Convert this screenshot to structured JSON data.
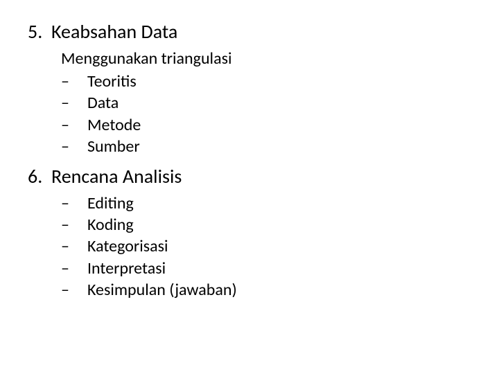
{
  "section5": {
    "number": "5.",
    "title": "Keabsahan Data",
    "intro": "Menggunakan triangulasi",
    "dash": "–",
    "items": [
      "Teoritis",
      "Data",
      "Metode",
      "Sumber"
    ]
  },
  "section6": {
    "number": "6.",
    "title": "Rencana Analisis",
    "dash": "–",
    "items": [
      "Editing",
      "Koding",
      "Kategorisasi",
      "Interpretasi",
      "Kesimpulan (jawaban)"
    ]
  }
}
